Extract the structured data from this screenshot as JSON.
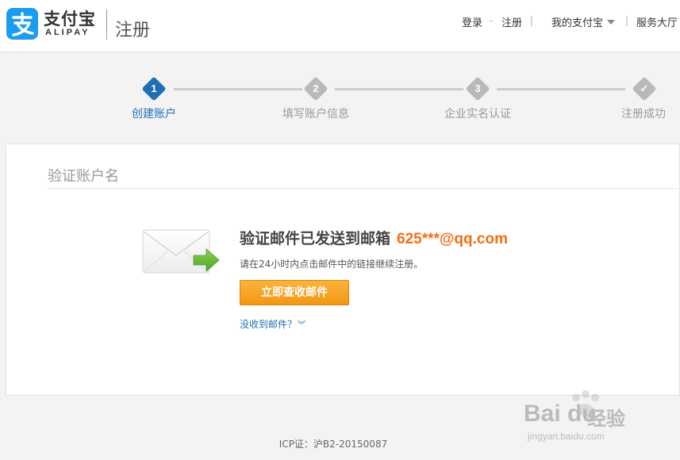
{
  "header": {
    "logo_cn": "支付宝",
    "logo_en": "ALIPAY",
    "page_name": "注册",
    "nav": {
      "login": "登录",
      "register": "注册",
      "my_alipay": "我的支付宝",
      "service_hall": "服务大厅",
      "sep_dash": "-",
      "sep_bar": "|"
    }
  },
  "steps": [
    {
      "num": "1",
      "label": "创建账户",
      "state": "active"
    },
    {
      "num": "2",
      "label": "填写账户信息",
      "state": "pending"
    },
    {
      "num": "3",
      "label": "企业实名认证",
      "state": "pending"
    },
    {
      "num": "✓",
      "label": "注册成功",
      "state": "pending"
    }
  ],
  "panel": {
    "title": "验证账户名",
    "message": "验证邮件已发送到邮箱",
    "email": "625***@qq.com",
    "hint": "请在24小时内点击邮件中的链接继续注册。",
    "check_button": "立即查收邮件",
    "no_mail_link": "没收到邮件？",
    "no_mail_icon": "»"
  },
  "footer": {
    "icp": "ICP证：沪B2-20150087"
  },
  "watermark": {
    "brand": "Bai du",
    "name": "经验",
    "url": "jingyan.baidu.com"
  },
  "colors": {
    "brand_blue": "#1a9cf0",
    "active_step": "#1f6fb5",
    "inactive_step": "#b9b9b9",
    "email_orange": "#f36f13",
    "button_orange": "#f29712"
  }
}
